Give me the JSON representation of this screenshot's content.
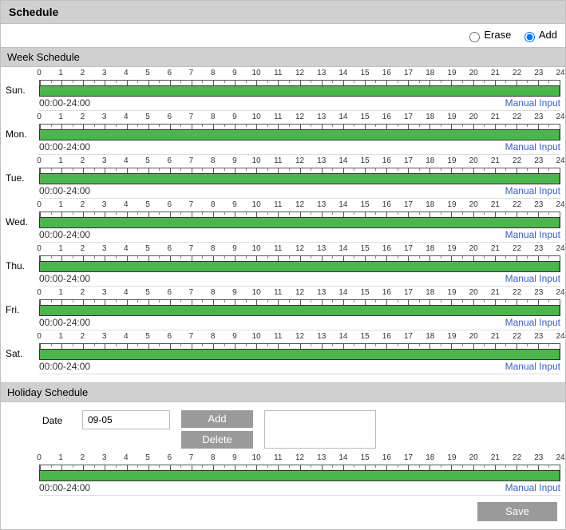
{
  "header": {
    "title": "Schedule"
  },
  "mode": {
    "erase_label": "Erase",
    "add_label": "Add",
    "selected": "add"
  },
  "week": {
    "title": "Week Schedule",
    "manual_label": "Manual Input",
    "hours": [
      "0",
      "1",
      "2",
      "3",
      "4",
      "5",
      "6",
      "7",
      "8",
      "9",
      "10",
      "11",
      "12",
      "13",
      "14",
      "15",
      "16",
      "17",
      "18",
      "19",
      "20",
      "21",
      "22",
      "23",
      "24"
    ],
    "days": [
      {
        "label": "Sun.",
        "range_text": "00:00-24:00",
        "range": [
          0,
          24
        ]
      },
      {
        "label": "Mon.",
        "range_text": "00:00-24:00",
        "range": [
          0,
          24
        ]
      },
      {
        "label": "Tue.",
        "range_text": "00:00-24:00",
        "range": [
          0,
          24
        ]
      },
      {
        "label": "Wed.",
        "range_text": "00:00-24:00",
        "range": [
          0,
          24
        ]
      },
      {
        "label": "Thu.",
        "range_text": "00:00-24:00",
        "range": [
          0,
          24
        ]
      },
      {
        "label": "Fri.",
        "range_text": "00:00-24:00",
        "range": [
          0,
          24
        ]
      },
      {
        "label": "Sat.",
        "range_text": "00:00-24:00",
        "range": [
          0,
          24
        ]
      }
    ]
  },
  "holiday": {
    "title": "Holiday Schedule",
    "date_label": "Date",
    "date_value": "09-05",
    "add_label": "Add",
    "delete_label": "Delete",
    "manual_label": "Manual Input",
    "hours": [
      "0",
      "1",
      "2",
      "3",
      "4",
      "5",
      "6",
      "7",
      "8",
      "9",
      "10",
      "11",
      "12",
      "13",
      "14",
      "15",
      "16",
      "17",
      "18",
      "19",
      "20",
      "21",
      "22",
      "23",
      "24"
    ],
    "day": {
      "range_text": "00:00-24:00",
      "range": [
        0,
        24
      ]
    }
  },
  "footer": {
    "save_label": "Save"
  }
}
